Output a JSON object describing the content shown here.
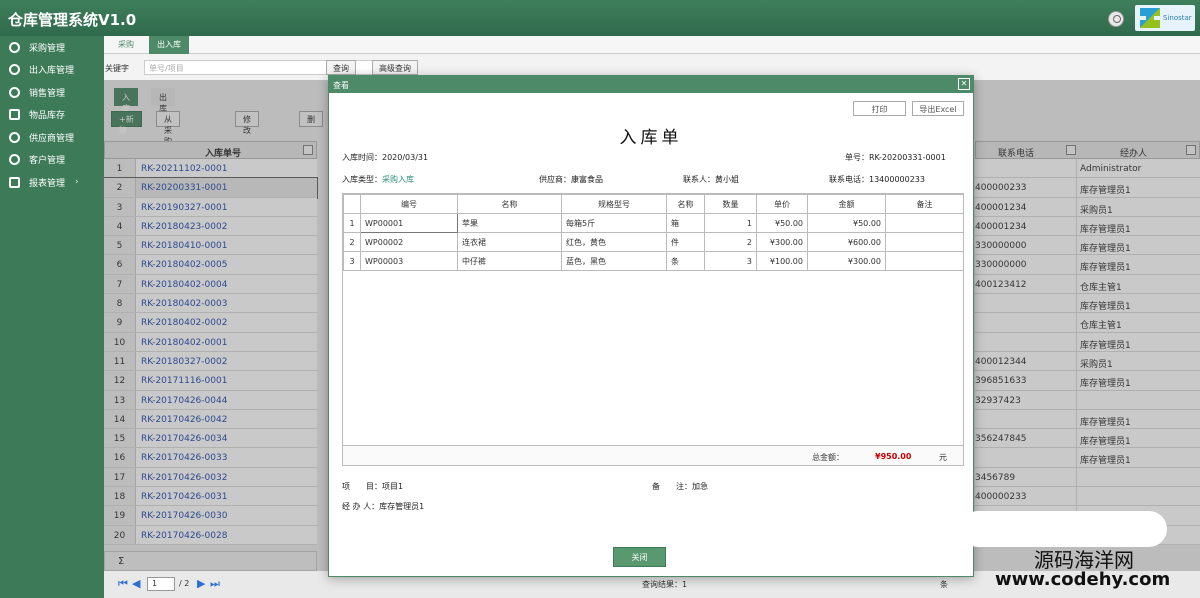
{
  "app": {
    "title": "仓库管理系统V1.0",
    "logo_text": "Sinostar"
  },
  "sidebar": {
    "items": [
      {
        "label": "采购管理"
      },
      {
        "label": "出入库管理"
      },
      {
        "label": "销售管理"
      },
      {
        "label": "物品库存"
      },
      {
        "label": "供应商管理"
      },
      {
        "label": "客户管理"
      },
      {
        "label": "报表管理"
      }
    ]
  },
  "tabs": [
    "采购",
    "出入库"
  ],
  "search": {
    "label": "关键字",
    "placeholder": "单号/项目",
    "query_btn": "查询",
    "advanced_btn": "高级查询"
  },
  "subtabs": [
    "入库",
    "出库"
  ],
  "toolbar": {
    "new": "+新建",
    "from_purchase": "从采购单选择",
    "edit": "修改",
    "delete": "删"
  },
  "grid": {
    "header": "入库单号",
    "rows": [
      {
        "num": "1",
        "code": "RK-20211102-0001"
      },
      {
        "num": "2",
        "code": "RK-20200331-0001"
      },
      {
        "num": "3",
        "code": "RK-20190327-0001"
      },
      {
        "num": "4",
        "code": "RK-20180423-0002"
      },
      {
        "num": "5",
        "code": "RK-20180410-0001"
      },
      {
        "num": "6",
        "code": "RK-20180402-0005"
      },
      {
        "num": "7",
        "code": "RK-20180402-0004"
      },
      {
        "num": "8",
        "code": "RK-20180402-0003"
      },
      {
        "num": "9",
        "code": "RK-20180402-0002"
      },
      {
        "num": "10",
        "code": "RK-20180402-0001"
      },
      {
        "num": "11",
        "code": "RK-20180327-0002"
      },
      {
        "num": "12",
        "code": "RK-20171116-0001"
      },
      {
        "num": "13",
        "code": "RK-20170426-0044"
      },
      {
        "num": "14",
        "code": "RK-20170426-0042"
      },
      {
        "num": "15",
        "code": "RK-20170426-0034"
      },
      {
        "num": "16",
        "code": "RK-20170426-0033"
      },
      {
        "num": "17",
        "code": "RK-20170426-0032"
      },
      {
        "num": "18",
        "code": "RK-20170426-0031"
      },
      {
        "num": "19",
        "code": "RK-20170426-0030"
      },
      {
        "num": "20",
        "code": "RK-20170426-0028"
      }
    ],
    "right_headers": [
      "联系电话",
      "经办人"
    ],
    "right_rows": [
      {
        "phone": "",
        "handler": "Administrator"
      },
      {
        "phone": "400000233",
        "handler": "库存管理员1"
      },
      {
        "phone": "400001234",
        "handler": "采购员1"
      },
      {
        "phone": "400001234",
        "handler": "库存管理员1"
      },
      {
        "phone": "330000000",
        "handler": "库存管理员1"
      },
      {
        "phone": "330000000",
        "handler": "库存管理员1"
      },
      {
        "phone": "400123412",
        "handler": "仓库主管1"
      },
      {
        "phone": "",
        "handler": "库存管理员1"
      },
      {
        "phone": "",
        "handler": "仓库主管1"
      },
      {
        "phone": "",
        "handler": "库存管理员1"
      },
      {
        "phone": "400012344",
        "handler": "采购员1"
      },
      {
        "phone": "396851633",
        "handler": "库存管理员1"
      },
      {
        "phone": "32937423",
        "handler": ""
      },
      {
        "phone": "",
        "handler": "库存管理员1"
      },
      {
        "phone": "356247845",
        "handler": "库存管理员1"
      },
      {
        "phone": "",
        "handler": "库存管理员1"
      },
      {
        "phone": "3456789",
        "handler": ""
      },
      {
        "phone": "400000233",
        "handler": ""
      },
      {
        "phone": "",
        "handler": ""
      },
      {
        "phone": "",
        "handler": ""
      }
    ],
    "sigma": "Σ"
  },
  "pager": {
    "page": "1",
    "total": "/ 2",
    "query_result": "查询结果：1",
    "count": "条"
  },
  "modal": {
    "title": "查看",
    "print_btn": "打印",
    "export_btn": "导出Excel",
    "doc_title": "入库单",
    "time": "入库时间：2020/03/31",
    "doc_no": "单号：RK-20200331-0001",
    "type_label": "入库类型：",
    "type_value": "采购入库",
    "supplier": "供应商：康富食品",
    "contact": "联系人：黄小姐",
    "contact_phone": "联系电话：13400000233",
    "columns": [
      "",
      "编号",
      "名称",
      "规格型号",
      "名称",
      "数量",
      "单价",
      "金额",
      "备注"
    ],
    "items": [
      {
        "idx": "1",
        "code": "WP00001",
        "name": "苹果",
        "spec": "每箱5斤",
        "unit": "箱",
        "qty": "1",
        "price": "¥50.00",
        "amount": "¥50.00",
        "note": ""
      },
      {
        "idx": "2",
        "code": "WP00002",
        "name": "连衣裙",
        "spec": "红色，黄色",
        "unit": "件",
        "qty": "2",
        "price": "¥300.00",
        "amount": "¥600.00",
        "note": ""
      },
      {
        "idx": "3",
        "code": "WP00003",
        "name": "中仔裤",
        "spec": "蓝色，黑色",
        "unit": "条",
        "qty": "3",
        "price": "¥100.00",
        "amount": "¥300.00",
        "note": ""
      }
    ],
    "total_label": "总金额：",
    "total_value": "¥950.00",
    "total_unit": "元",
    "project": "项　　目：项目1",
    "note": "备　　注：加急",
    "handler": "经 办 人：库存管理员1",
    "close_btn": "关闭"
  },
  "watermark": {
    "line1": "源码海洋网",
    "line2": "www.codehy.com"
  }
}
